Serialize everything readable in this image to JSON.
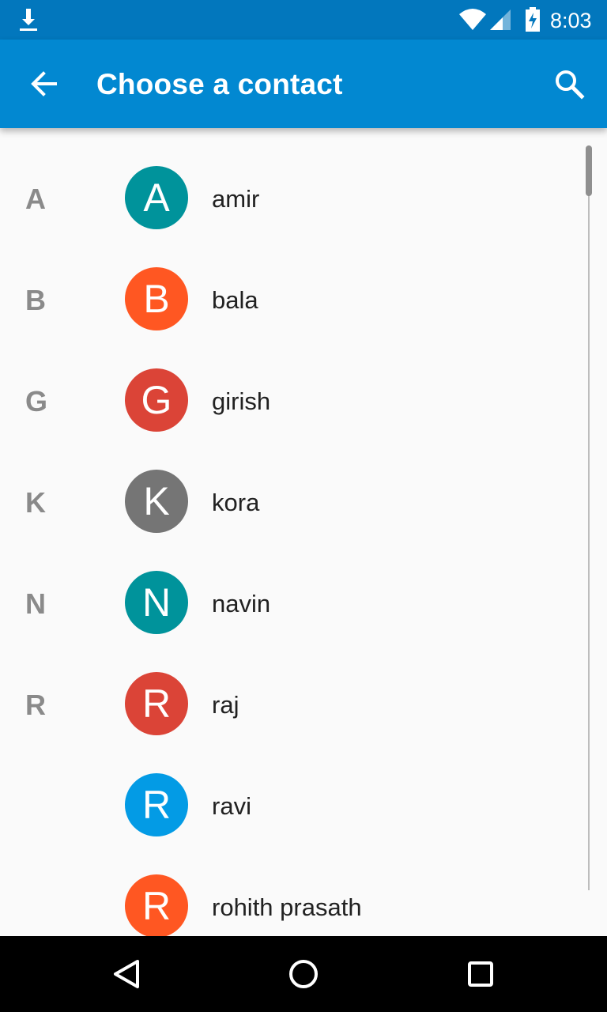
{
  "status_bar": {
    "time": "8:03",
    "icons": [
      "download-icon",
      "wifi-icon",
      "cell-signal-icon",
      "battery-charging-icon"
    ]
  },
  "app_bar": {
    "title": "Choose a contact",
    "color": "#0288d1",
    "icons": [
      "back-arrow-icon",
      "search-icon"
    ]
  },
  "contacts": [
    {
      "section": "A",
      "initial": "A",
      "name": "amir",
      "color": "#00939b"
    },
    {
      "section": "B",
      "initial": "B",
      "name": "bala",
      "color": "#ff5722"
    },
    {
      "section": "G",
      "initial": "G",
      "name": "girish",
      "color": "#db4437"
    },
    {
      "section": "K",
      "initial": "K",
      "name": "kora",
      "color": "#757575"
    },
    {
      "section": "N",
      "initial": "N",
      "name": "navin",
      "color": "#00939b"
    },
    {
      "section": "R",
      "initial": "R",
      "name": "raj",
      "color": "#db4437"
    },
    {
      "section": "",
      "initial": "R",
      "name": "ravi",
      "color": "#039be5"
    },
    {
      "section": "",
      "initial": "R",
      "name": "rohith prasath",
      "color": "#ff5722"
    }
  ],
  "nav_bar": {
    "icons": [
      "back-triangle-icon",
      "home-circle-icon",
      "recents-square-icon"
    ]
  }
}
